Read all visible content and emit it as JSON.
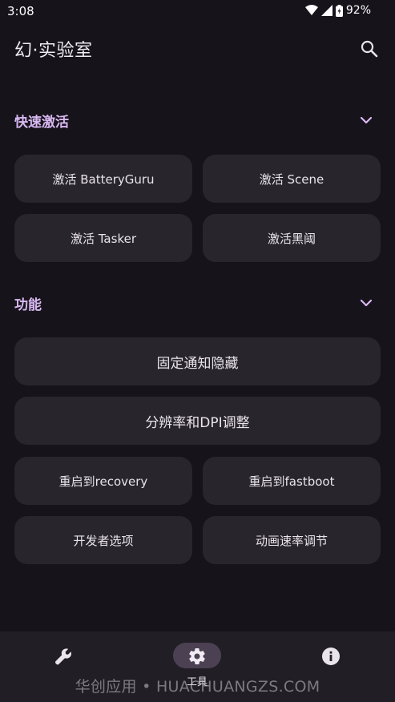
{
  "status_bar": {
    "time": "3:08",
    "battery": "92%",
    "icons": [
      "wifi-icon",
      "signal-icon",
      "battery-icon"
    ]
  },
  "app_bar": {
    "title": "幻·实验室",
    "search_icon": "search-icon"
  },
  "sections": {
    "quick_activate": {
      "title": "快速激活",
      "buttons": [
        "激活 BatteryGuru",
        "激活 Scene",
        "激活 Tasker",
        "激活黑阈"
      ]
    },
    "functions": {
      "title": "功能",
      "buttons": [
        "固定通知隐藏",
        "分辨率和DPI调整",
        "重启到recovery",
        "重启到fastboot",
        "开发者选项",
        "动画速率调节"
      ]
    }
  },
  "bottom_nav": {
    "items": [
      {
        "icon": "wrench-icon",
        "label": ""
      },
      {
        "icon": "gear-icon",
        "label": "工具"
      },
      {
        "icon": "info-icon",
        "label": ""
      }
    ]
  },
  "watermark": "华创应用 • HUACHUANGZS.COM",
  "colors": {
    "background": "#17131b",
    "card": "#29252d",
    "accent": "#d9b9f2",
    "nav_background": "#221e26",
    "nav_pill": "#4b4153"
  }
}
